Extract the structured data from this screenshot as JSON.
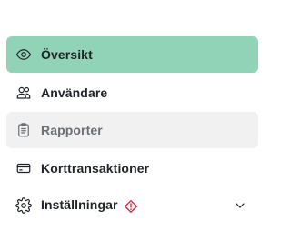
{
  "nav": {
    "items": [
      {
        "label": "Översikt",
        "icon": "eye-icon",
        "state": "active"
      },
      {
        "label": "Användare",
        "icon": "users-icon",
        "state": "default"
      },
      {
        "label": "Rapporter",
        "icon": "clipboard-icon",
        "state": "hover"
      },
      {
        "label": "Korttransaktioner",
        "icon": "credit-card-icon",
        "state": "default"
      },
      {
        "label": "Inställningar",
        "icon": "gear-icon",
        "state": "default",
        "badge_icon": "warning-icon",
        "expandable": true,
        "expand_icon": "chevron-down-icon"
      }
    ]
  },
  "colors": {
    "active_bg": "#91d3b7",
    "hover_bg": "#f1f1f1",
    "warning": "#d7263d",
    "text": "#1f2328",
    "muted_text": "#6b6f73"
  }
}
